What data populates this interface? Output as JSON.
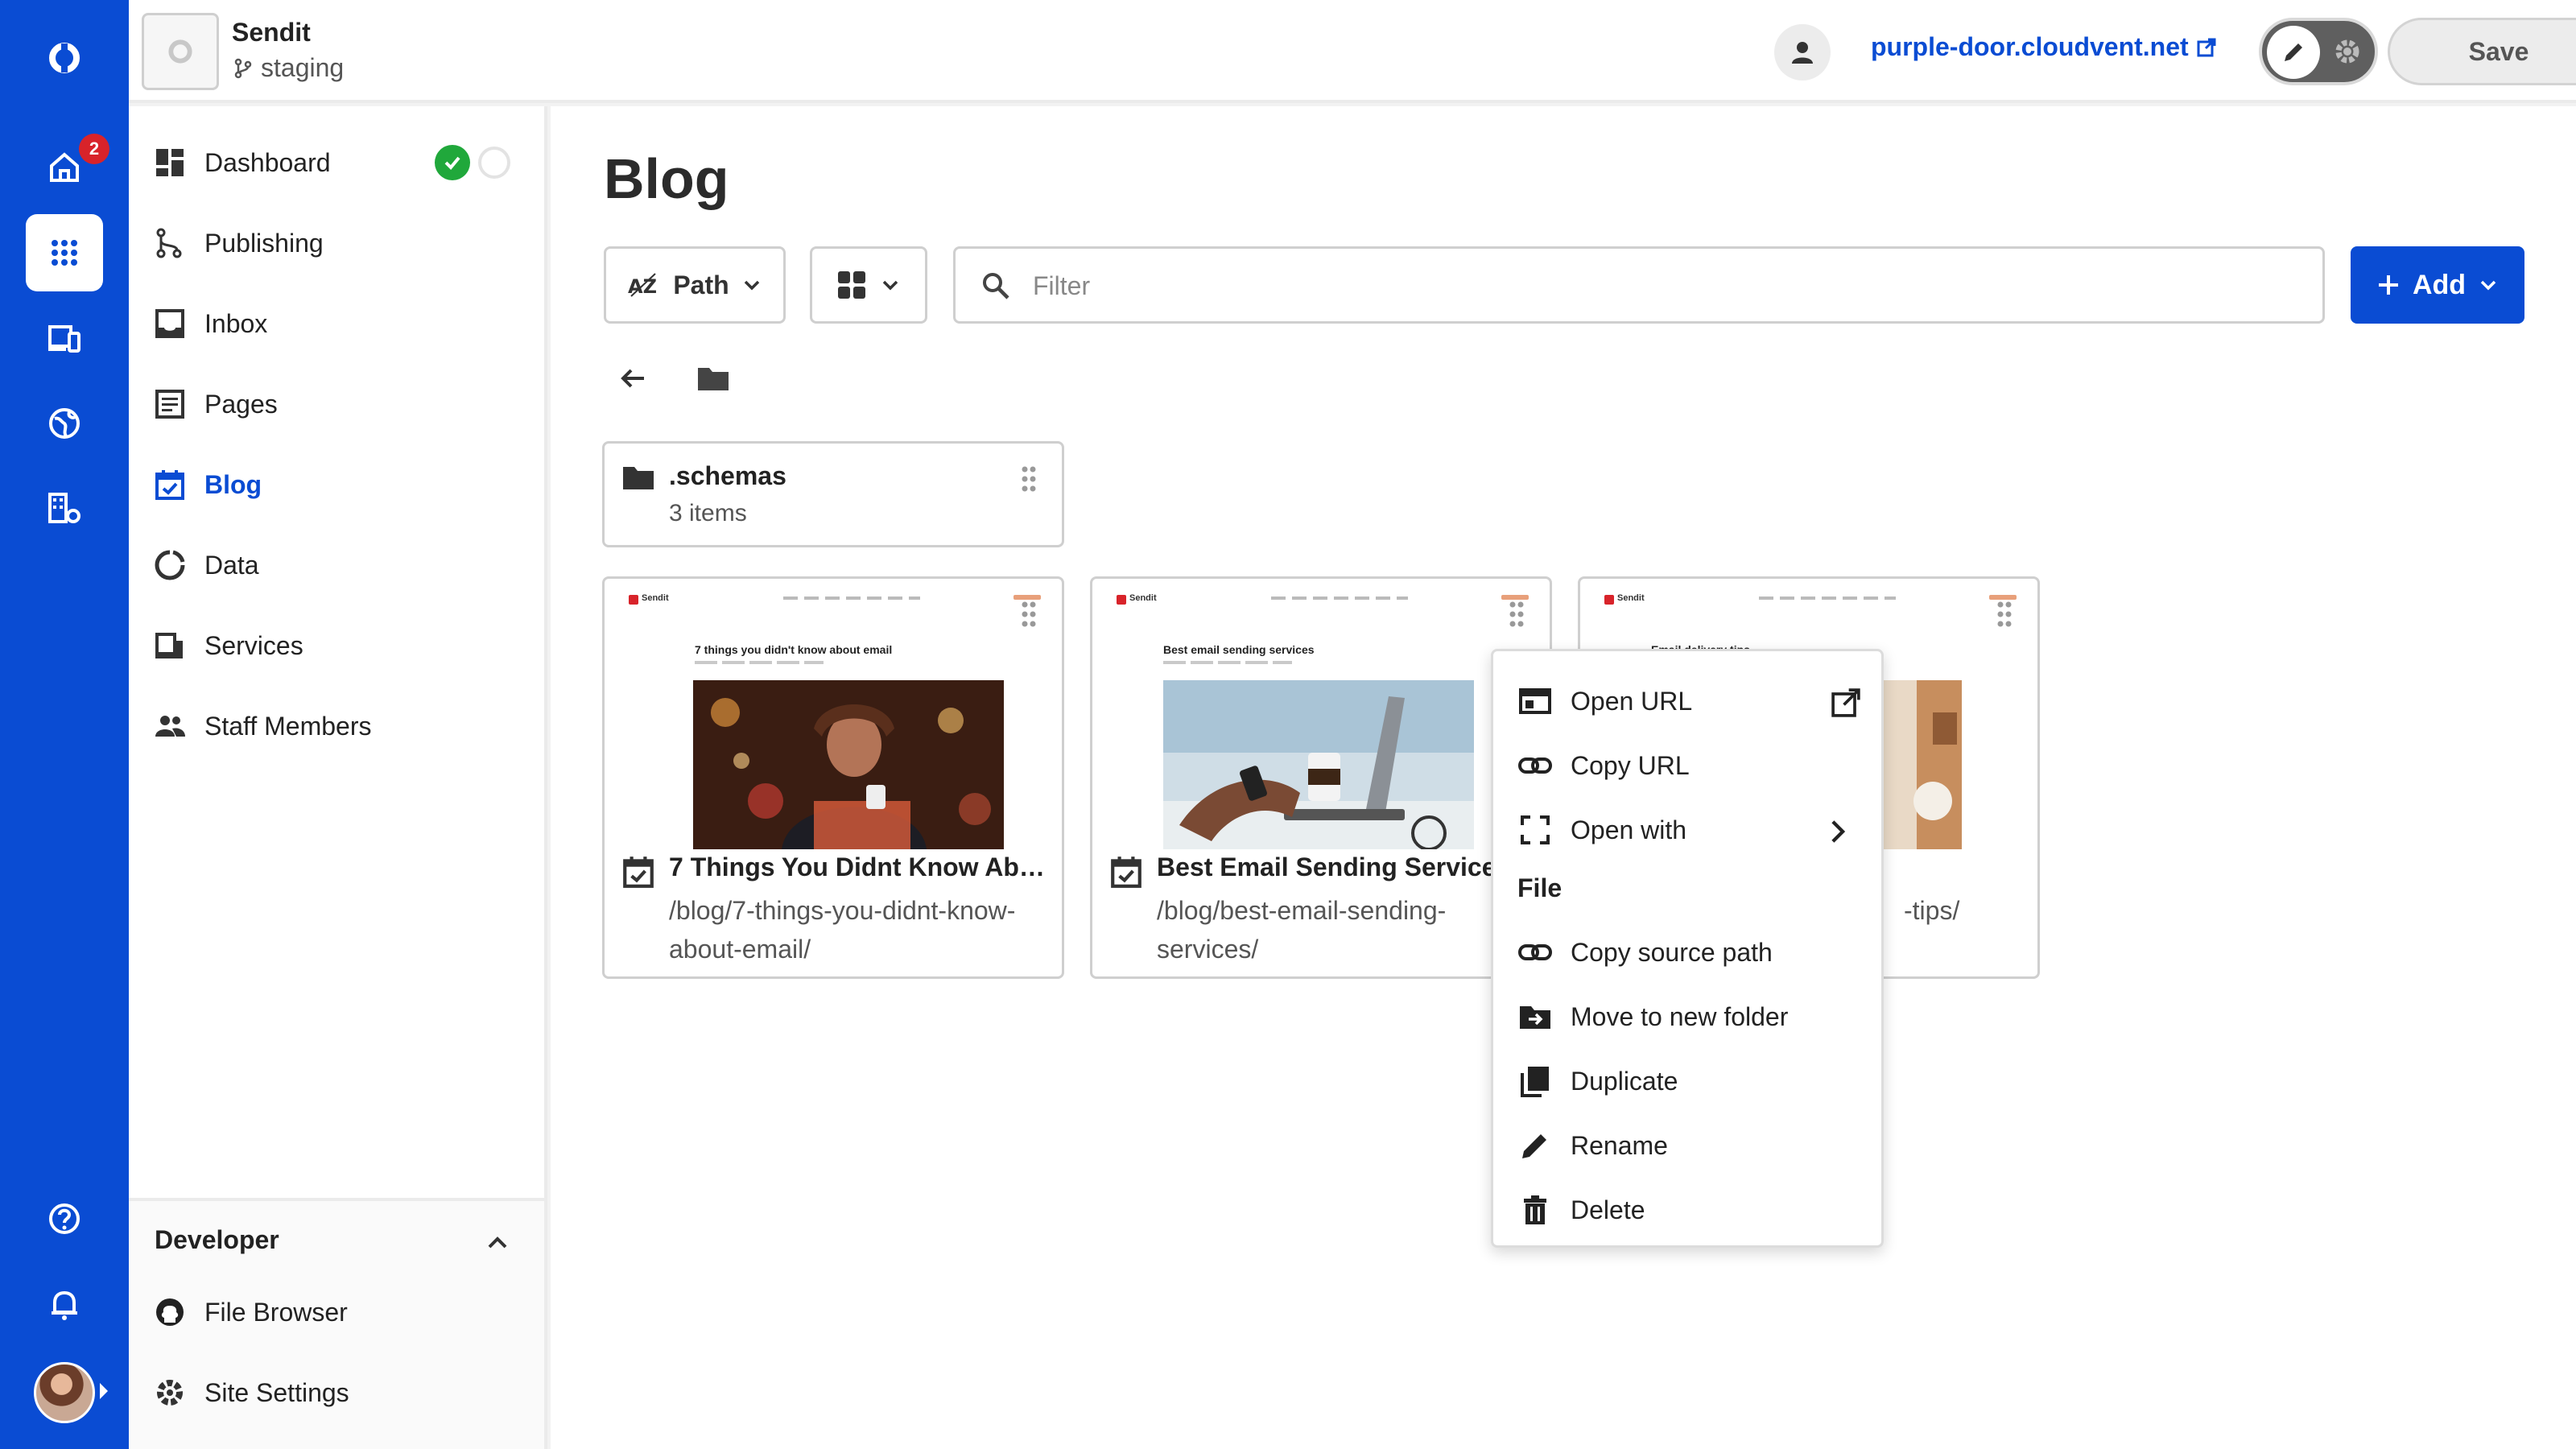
{
  "app": {
    "site_name": "Sendit",
    "branch": "staging",
    "site_url": "purple-door.cloudvent.net",
    "save_label": "Save",
    "notification_count": "2"
  },
  "sidebar": {
    "items": [
      {
        "label": "Dashboard",
        "icon": "dashboard-icon"
      },
      {
        "label": "Publishing",
        "icon": "publishing-icon"
      },
      {
        "label": "Inbox",
        "icon": "inbox-icon"
      },
      {
        "label": "Pages",
        "icon": "pages-icon"
      },
      {
        "label": "Blog",
        "icon": "blog-icon",
        "active": true
      },
      {
        "label": "Data",
        "icon": "data-icon"
      },
      {
        "label": "Services",
        "icon": "services-icon"
      },
      {
        "label": "Staff Members",
        "icon": "staff-icon"
      }
    ],
    "developer": {
      "title": "Developer",
      "items": [
        {
          "label": "File Browser",
          "icon": "github-icon"
        },
        {
          "label": "Site Settings",
          "icon": "gear-icon"
        }
      ]
    }
  },
  "main": {
    "title": "Blog",
    "sort_label": "Path",
    "filter_placeholder": "Filter",
    "add_label": "Add",
    "folder": {
      "name": ".schemas",
      "count": "3 items"
    },
    "cards": [
      {
        "title": "7 Things You Didnt Know Abo...",
        "path": "/blog/7-things-you-didnt-know-about-email/",
        "preview_brand": "Sendit",
        "preview_title": "7 things you didn't know about email"
      },
      {
        "title": "Best Email Sending Services",
        "path": "/blog/best-email-sending-services/",
        "preview_brand": "Sendit",
        "preview_title": "Best email sending services"
      },
      {
        "title": "",
        "path": "-tips/",
        "preview_brand": "Sendit",
        "preview_title": "Email delivery tips"
      }
    ]
  },
  "context_menu": {
    "items_top": [
      {
        "label": "Open URL",
        "icon": "open-url-icon"
      },
      {
        "label": "Copy URL",
        "icon": "link-icon"
      },
      {
        "label": "Open with",
        "icon": "expand-icon"
      }
    ],
    "section": "File",
    "items_file": [
      {
        "label": "Copy source path",
        "icon": "link-icon"
      },
      {
        "label": "Move to new folder",
        "icon": "move-folder-icon"
      },
      {
        "label": "Duplicate",
        "icon": "duplicate-icon"
      },
      {
        "label": "Rename",
        "icon": "pencil-icon"
      },
      {
        "label": "Delete",
        "icon": "trash-icon"
      }
    ]
  },
  "colors": {
    "brand": "#0a4cd3",
    "success": "#20a83b",
    "badge": "#d8232a"
  }
}
